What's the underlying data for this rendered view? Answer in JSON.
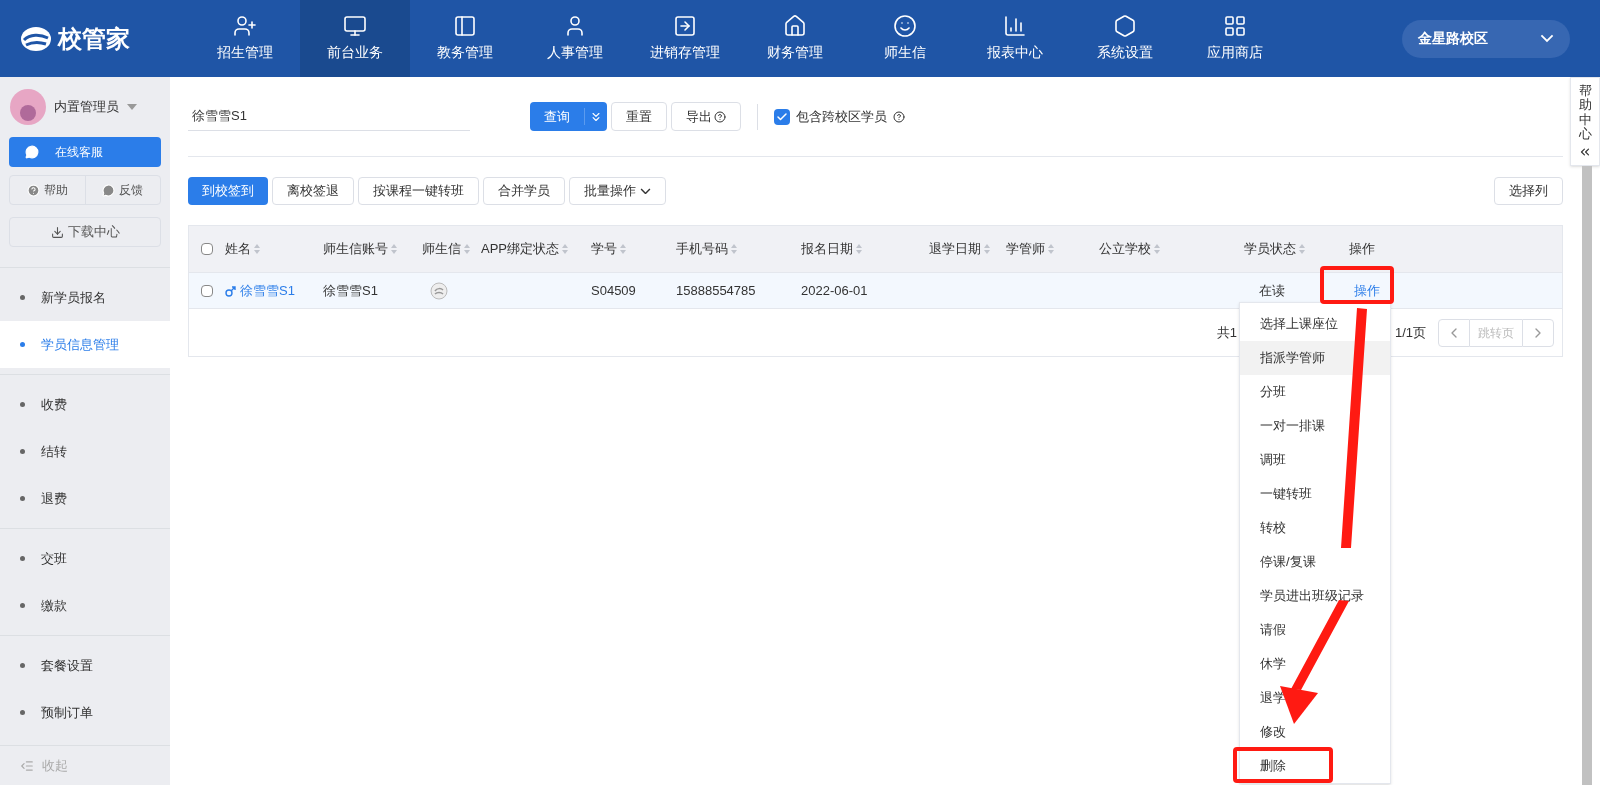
{
  "brand": {
    "name": "校管家"
  },
  "nav": [
    {
      "label": "招生管理",
      "selected": false
    },
    {
      "label": "前台业务",
      "selected": true
    },
    {
      "label": "教务管理",
      "selected": false
    },
    {
      "label": "人事管理",
      "selected": false
    },
    {
      "label": "进销存管理",
      "selected": false
    },
    {
      "label": "财务管理",
      "selected": false
    },
    {
      "label": "师生信",
      "selected": false
    },
    {
      "label": "报表中心",
      "selected": false
    },
    {
      "label": "系统设置",
      "selected": false
    },
    {
      "label": "应用商店",
      "selected": false
    }
  ],
  "campus": {
    "label": "金星路校区"
  },
  "sidebar": {
    "user": "内置管理员",
    "service": "在线客服",
    "help": "帮助",
    "feedback": "反馈",
    "download": "下载中心",
    "groups": [
      [
        {
          "label": "新学员报名",
          "selected": false
        },
        {
          "label": "学员信息管理",
          "selected": true
        }
      ],
      [
        {
          "label": "收费",
          "selected": false
        },
        {
          "label": "结转",
          "selected": false
        },
        {
          "label": "退费",
          "selected": false
        }
      ],
      [
        {
          "label": "交班",
          "selected": false
        },
        {
          "label": "缴款",
          "selected": false
        }
      ],
      [
        {
          "label": "套餐设置",
          "selected": false
        },
        {
          "label": "预制订单",
          "selected": false
        }
      ]
    ],
    "collapse": "收起"
  },
  "filter": {
    "search": "徐雪雪S1",
    "query": "查询",
    "reset": "重置",
    "export": "导出",
    "cross_campus": {
      "label": "包含跨校区学员",
      "checked": true
    }
  },
  "actions": [
    "到校签到",
    "离校签退",
    "按课程一键转班",
    "合并学员",
    "批量操作"
  ],
  "choose_columns": "选择列",
  "table": {
    "all_checked": false,
    "columns": [
      {
        "label": "姓名",
        "sortable": true
      },
      {
        "label": "师生信账号",
        "sortable": true
      },
      {
        "label": "师生信",
        "sortable": true
      },
      {
        "label": "APP绑定状态",
        "sortable": true
      },
      {
        "label": "学号",
        "sortable": true
      },
      {
        "label": "手机号码",
        "sortable": true
      },
      {
        "label": "报名日期",
        "sortable": true
      },
      {
        "label": "退学日期",
        "sortable": true
      },
      {
        "label": "学管师",
        "sortable": true
      },
      {
        "label": "公立学校",
        "sortable": true
      },
      {
        "label": "学员状态",
        "sortable": true
      },
      {
        "label": "操作",
        "sortable": false
      }
    ],
    "rows": [
      {
        "checked": false,
        "name": "徐雪雪S1",
        "account": "徐雪雪S1",
        "student_no": "S04509",
        "phone": "15888554785",
        "enrolled": "2022-06-01",
        "withdrawn": "",
        "manager": "",
        "school": "",
        "status": "在读",
        "action": "操作"
      }
    ]
  },
  "pagination": {
    "total": "共1",
    "pages": "1/1页",
    "jump_placeholder": "跳转页"
  },
  "action_menu": [
    {
      "label": "选择上课座位",
      "highlighted": false
    },
    {
      "label": "指派学管师",
      "highlighted": true
    },
    {
      "label": "分班",
      "highlighted": false
    },
    {
      "label": "一对一排课",
      "highlighted": false
    },
    {
      "label": "调班",
      "highlighted": false
    },
    {
      "label": "一键转班",
      "highlighted": false
    },
    {
      "label": "转校",
      "highlighted": false
    },
    {
      "label": "停课/复课",
      "highlighted": false
    },
    {
      "label": "学员进出班级记录",
      "highlighted": false
    },
    {
      "label": "请假",
      "highlighted": false
    },
    {
      "label": "休学",
      "highlighted": false
    },
    {
      "label": "退学",
      "highlighted": false
    },
    {
      "label": "修改",
      "highlighted": false
    },
    {
      "label": "删除",
      "highlighted": false
    }
  ],
  "help_center": "帮助中心"
}
